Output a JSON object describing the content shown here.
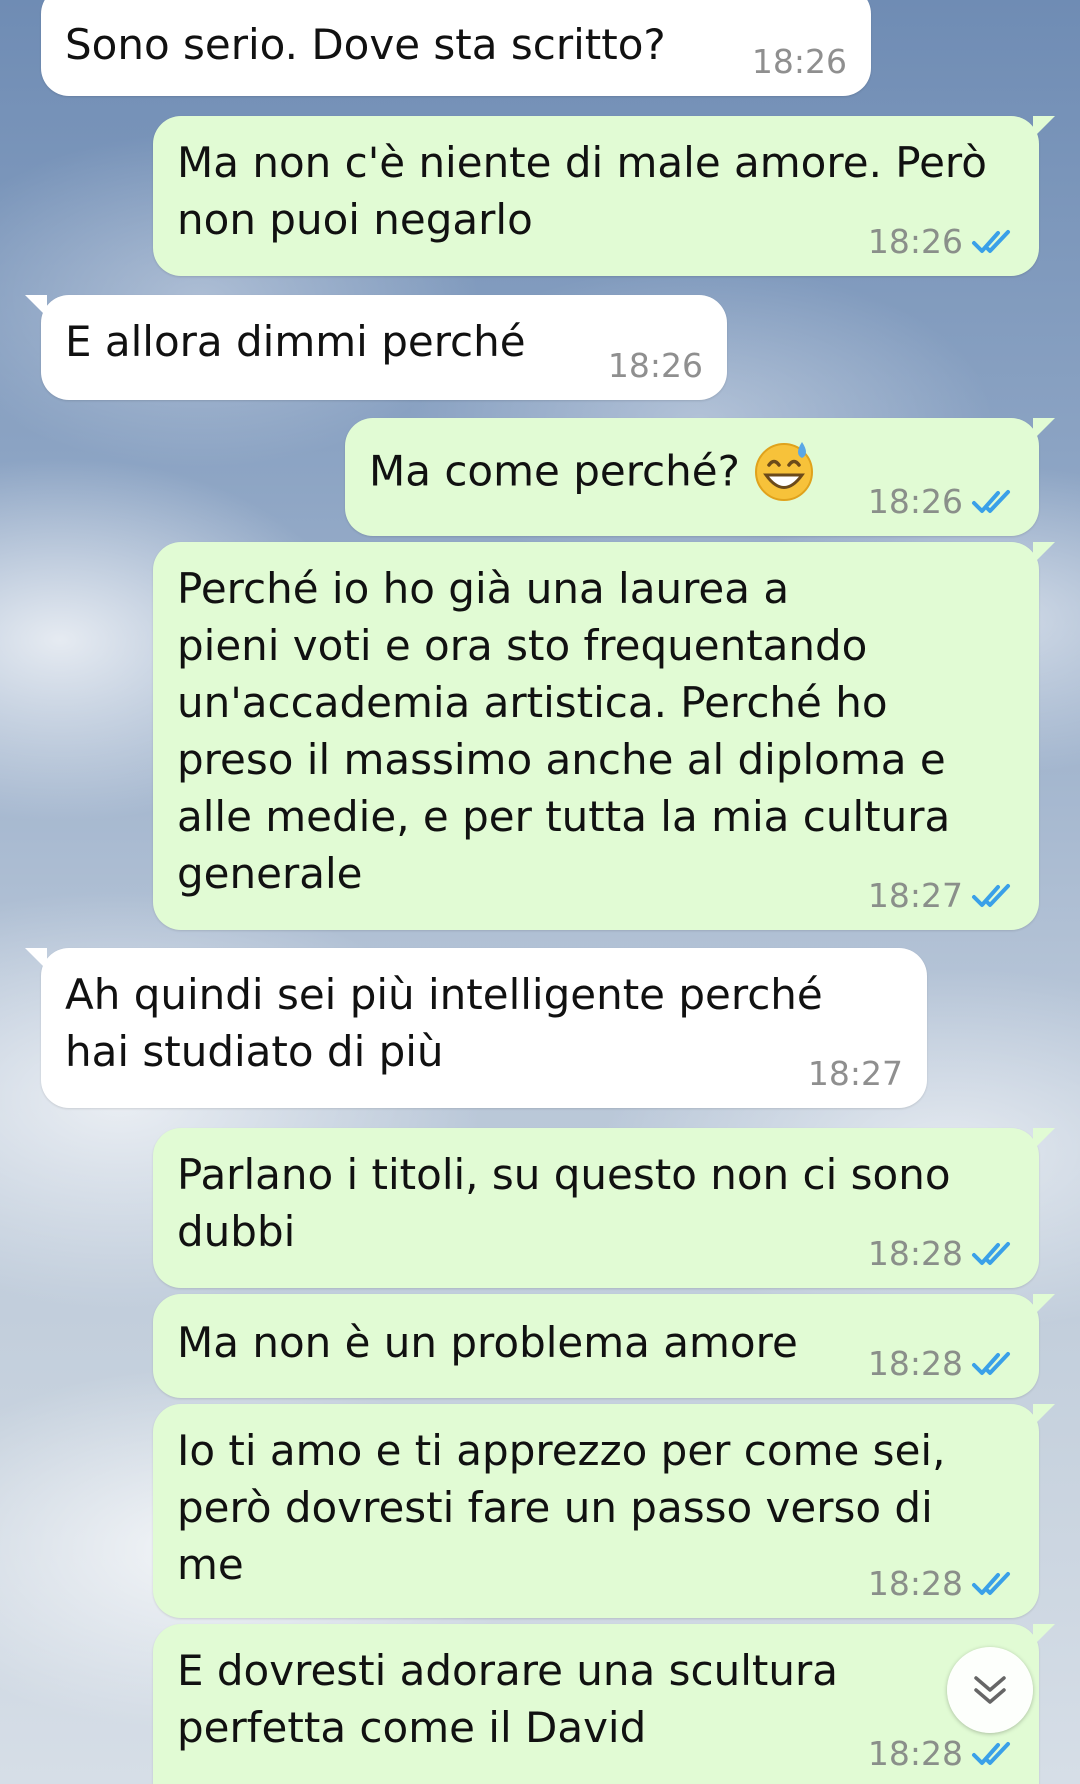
{
  "chat": {
    "messages": [
      {
        "direction": "incoming",
        "text": "Sono serio. Dove sta scritto?",
        "time": "18:26"
      },
      {
        "direction": "outgoing",
        "text": "Ma non c'è niente di male amore. Però\nnon puoi negarlo",
        "time": "18:26",
        "status": "read"
      },
      {
        "direction": "incoming",
        "text": "E allora dimmi perché",
        "time": "18:26"
      },
      {
        "direction": "outgoing",
        "text": "Ma come perché?",
        "emoji": "grinning-face-with-sweat",
        "time": "18:26",
        "status": "read"
      },
      {
        "direction": "outgoing",
        "text": "Perché io ho già una laurea a\npieni voti e ora sto frequentando\nun'accademia artistica. Perché ho\npreso il massimo anche al diploma e\nalle medie, e per tutta la mia cultura\ngenerale",
        "time": "18:27",
        "status": "read"
      },
      {
        "direction": "incoming",
        "text": "Ah quindi sei più intelligente perché\nhai studiato di più",
        "time": "18:27"
      },
      {
        "direction": "outgoing",
        "text": "Parlano i titoli, su questo non ci sono\ndubbi",
        "time": "18:28",
        "status": "read"
      },
      {
        "direction": "outgoing",
        "text": "Ma non è un problema amore",
        "time": "18:28",
        "status": "read"
      },
      {
        "direction": "outgoing",
        "text": "Io ti amo e ti apprezzo per come sei,\nperò dovresti fare un passo verso di\nme",
        "time": "18:28",
        "status": "read"
      },
      {
        "direction": "outgoing",
        "text": "E dovresti adorare una scultura\nperfetta come il David",
        "time": "18:28",
        "status": "read"
      }
    ]
  },
  "colors": {
    "incoming_bubble": "#ffffff",
    "outgoing_bubble": "#e1fbd4",
    "read_ticks": "#3aa0e8"
  },
  "icons": {
    "read_status": "double-check-icon",
    "scroll_down": "double-chevron-down-icon"
  }
}
